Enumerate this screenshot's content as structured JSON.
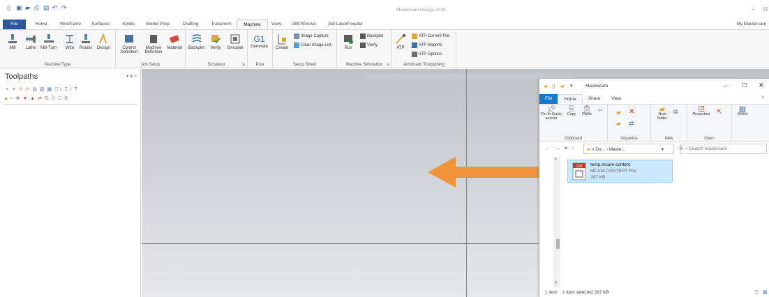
{
  "app": {
    "title": "Mastercam Design 2020",
    "user_label": "My Mastercam"
  },
  "tabs": [
    "File",
    "Home",
    "Wireframe",
    "Surfaces",
    "Solids",
    "Model Prep",
    "Drafting",
    "Transform",
    "Machine",
    "View",
    "AM:WireArc",
    "AM:LaserPowder"
  ],
  "active_tab": "Machine",
  "ribbon": {
    "machine_type": {
      "label": "Machine Type",
      "buttons": [
        "Mill",
        "Lathe",
        "Mill-Turn",
        "Wire",
        "Router",
        "Design"
      ]
    },
    "job_setup": {
      "label": "Job Setup",
      "control_def": "Control Definition",
      "machine_def": "Machine Definition",
      "material": "Material"
    },
    "simulator": {
      "label": "Simulator",
      "buttons": [
        "Backplot",
        "Verify",
        "Simulate"
      ]
    },
    "post": {
      "label": "Post",
      "g1": "G1",
      "generate": "Generate"
    },
    "setup_sheet": {
      "label": "Setup Sheet",
      "create": "Create",
      "image_capture": "Image Capture",
      "clear_image_list": "Clear Image List"
    },
    "machine_simulation": {
      "label": "Machine Simulation",
      "run": "Run",
      "backplot": "Backplot",
      "verify": "Verify"
    },
    "auto_toolpathing": {
      "label": "Automatic Toolpathing",
      "atp": "ATP",
      "current_file": "ATP Current File",
      "reports": "ATP Reports",
      "options": "ATP Options"
    }
  },
  "toolpaths": {
    "title": "Toolpaths",
    "controls": "▾ ⊞ ×"
  },
  "explorer": {
    "title": "Mastercam",
    "tabs": [
      "File",
      "Home",
      "Share",
      "View"
    ],
    "clipboard": {
      "label": "Clipboard",
      "pin": "Pin to Quick access",
      "copy": "Copy",
      "paste": "Paste"
    },
    "organize": {
      "label": "Organize"
    },
    "new": {
      "label": "New",
      "new_folder": "New folder"
    },
    "open": {
      "label": "Open",
      "properties": "Properties"
    },
    "select": {
      "label": "Select"
    },
    "address": "« Do... › Maste...",
    "search_placeholder": "Search Mastercam",
    "file": {
      "name": "temp.mcam-content",
      "type": "MCAM-CONTENT File",
      "size": "397 KB",
      "icon_label": "CNT"
    },
    "status_items": "1 item",
    "status_selected": "1 item selected  397 KB"
  },
  "colors": {
    "ribbon_file_tab": "#2b579a",
    "explorer_file_tab": "#1979ca",
    "arrow": "#f0933a",
    "selection": "#cce8ff"
  }
}
